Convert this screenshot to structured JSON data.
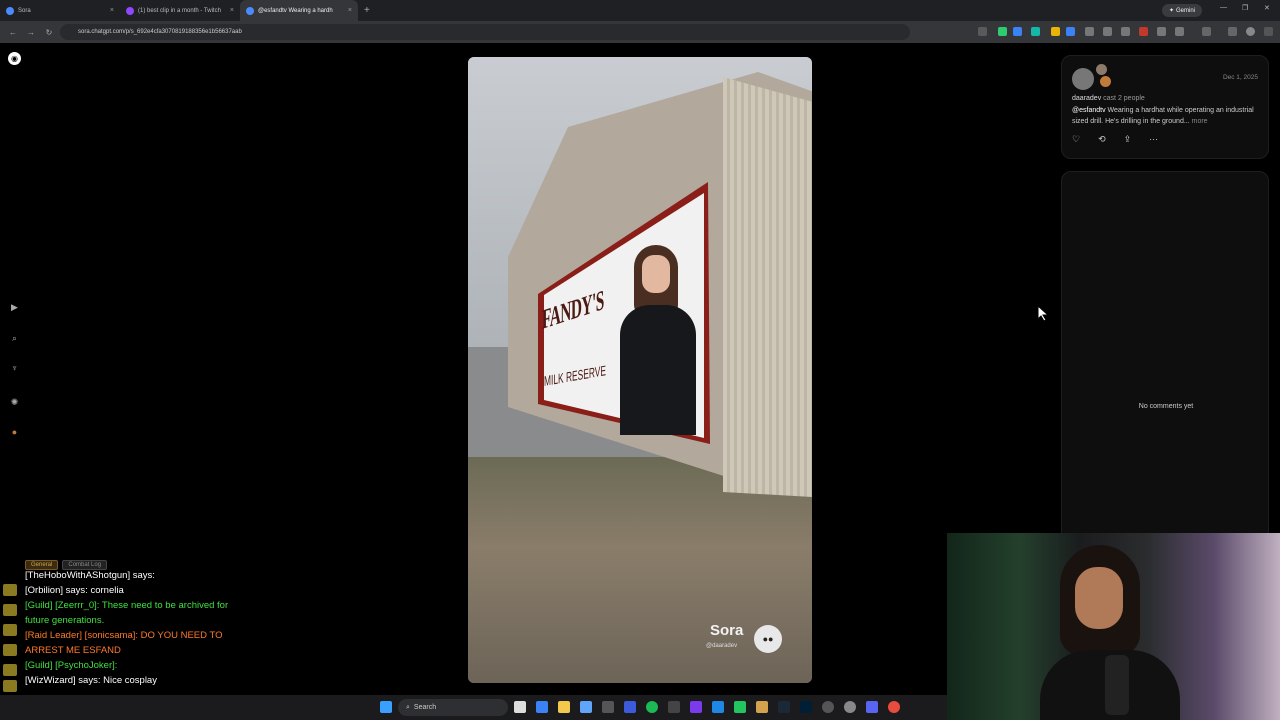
{
  "browser": {
    "tabs": [
      {
        "label": "Sora",
        "active": false
      },
      {
        "label": "(1) best clip in a month - Twitch",
        "active": false
      },
      {
        "label": "@esfandtv Wearing a hardh",
        "active": true
      }
    ],
    "url": "sora.chatgpt.com/p/s_692e4cfa3070819188356e1b56637aab",
    "gemini_label": "Gemini"
  },
  "post": {
    "watermark_brand": "Sora",
    "watermark_user": "@daaradev",
    "billboard_title": "FANDY'S",
    "billboard_subtitle": "MILK RESERVE",
    "author": "daaradev",
    "cast_text": "cast 2 people",
    "date": "Dec 1, 2025",
    "mention": "@esfandtv",
    "description": " Wearing a hardhat while operating an industrial sized drill. He's drilling in the ground...",
    "more_label": "more"
  },
  "comments": {
    "empty_text": "No comments yet"
  },
  "chat": {
    "tabs": [
      "General",
      "Combat Log"
    ],
    "lines": [
      {
        "text": "[TheHoboWithAShotgun] says:",
        "color": "#ffffff"
      },
      {
        "text": "[Orbilion] says: cornelia",
        "color": "#ffffff"
      },
      {
        "text": "[Guild] [Zeerrr_0]: These need to be archived for",
        "color": "#40e040"
      },
      {
        "text": "future generations.",
        "color": "#40e040"
      },
      {
        "text": "[Raid Leader] [sonicsama]: DO YOU NEED TO",
        "color": "#ff7a2a"
      },
      {
        "text": "ARREST ME ESFAND",
        "color": "#ff7a2a"
      },
      {
        "text": "[Guild] [PsychoJoker]:",
        "color": "#40e040"
      },
      {
        "text": "[WizWizard] says: Nice cosplay",
        "color": "#ffffff"
      }
    ]
  },
  "taskbar": {
    "search_label": "Search"
  },
  "icons": [
    "sora-logo-icon",
    "explore-icon",
    "search-icon",
    "trophy-icon",
    "activity-icon",
    "profile-icon",
    "heart-icon",
    "remix-icon",
    "share-icon",
    "more-icon"
  ]
}
